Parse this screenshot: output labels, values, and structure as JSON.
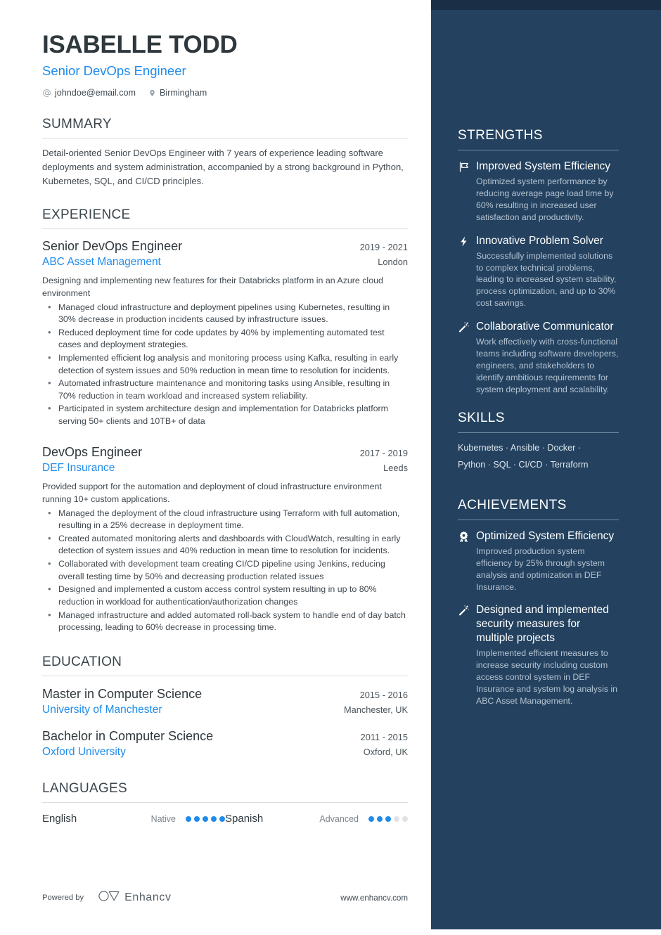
{
  "theme": {
    "accent_blue": "#1f8ceb",
    "sidebar_bg": "#24425f",
    "sidebar_topbar_bg": "#1a2f45",
    "heading_color": "#3b454c",
    "page_bg": "#ffffff"
  },
  "header": {
    "name": "ISABELLE TODD",
    "role": "Senior DevOps Engineer",
    "contacts": [
      {
        "icon": "at-icon",
        "text": "johndoe@email.com"
      },
      {
        "icon": "location-pin-icon",
        "text": "Birmingham"
      }
    ]
  },
  "summary": {
    "heading": "SUMMARY",
    "text": "Detail-oriented Senior DevOps Engineer with 7 years of experience leading software deployments and system administration, accompanied by a strong background in Python, Kubernetes, SQL, and CI/CD principles."
  },
  "experience": {
    "heading": "EXPERIENCE",
    "jobs": [
      {
        "title": "Senior DevOps Engineer",
        "dates": "2019 - 2021",
        "company": "ABC Asset Management",
        "location": "London",
        "description": "Designing and implementing new features for their Databricks platform in an Azure cloud environment",
        "bullets": [
          "Managed cloud infrastructure and deployment pipelines using Kubernetes, resulting in 30% decrease in production incidents caused by infrastructure issues.",
          "Reduced deployment time for code updates by 40% by implementing automated test cases and deployment strategies.",
          "Implemented efficient log analysis and monitoring process using Kafka, resulting in early detection of system issues and 50% reduction in mean time to resolution for incidents.",
          "Automated infrastructure maintenance and monitoring tasks using Ansible, resulting in 70% reduction in team workload and increased system reliability.",
          "Participated in system architecture design and implementation for Databricks platform serving 50+ clients and 10TB+ of data"
        ]
      },
      {
        "title": "DevOps Engineer",
        "dates": "2017 - 2019",
        "company": "DEF Insurance",
        "location": "Leeds",
        "description": "Provided support for the automation and deployment of cloud infrastructure environment running 10+ custom applications.",
        "bullets": [
          "Managed the deployment of the cloud infrastructure using Terraform with full automation, resulting in a 25% decrease in deployment time.",
          "Created automated monitoring alerts and dashboards with CloudWatch, resulting in early detection of system issues and 40% reduction in mean time to resolution for incidents.",
          "Collaborated with development team creating CI/CD pipeline using Jenkins, reducing overall testing time by 50% and decreasing production related issues",
          "Designed and implemented a custom access control system resulting in up to 80% reduction in workload for authentication/authorization changes",
          "Managed infrastructure and added automated roll-back system to handle end of day batch processing, leading to 60% decrease in processing time."
        ]
      }
    ]
  },
  "education": {
    "heading": "EDUCATION",
    "entries": [
      {
        "degree": "Master in Computer Science",
        "dates": "2015 - 2016",
        "school": "University of Manchester",
        "location": "Manchester, UK"
      },
      {
        "degree": "Bachelor in Computer Science",
        "dates": "2011 - 2015",
        "school": "Oxford University",
        "location": "Oxford, UK"
      }
    ]
  },
  "languages": {
    "heading": "LANGUAGES",
    "items": [
      {
        "name": "English",
        "level": "Native",
        "filled": 5,
        "total": 5
      },
      {
        "name": "Spanish",
        "level": "Advanced",
        "filled": 3,
        "total": 5
      }
    ]
  },
  "footer": {
    "powered_by": "Powered by",
    "brand": "Enhancv",
    "website": "www.enhancv.com"
  },
  "strengths": {
    "heading": "STRENGTHS",
    "items": [
      {
        "icon": "flag-icon",
        "title": "Improved System Efficiency",
        "desc": "Optimized system performance by reducing average page load time by 60% resulting in increased user satisfaction and productivity."
      },
      {
        "icon": "lightning-bolt-icon",
        "title": "Innovative Problem Solver",
        "desc": "Successfully implemented solutions to complex technical problems, leading to increased system stability, process optimization, and up to 30% cost savings."
      },
      {
        "icon": "magic-wand-icon",
        "title": "Collaborative Communicator",
        "desc": "Work effectively with cross-functional teams including software developers, engineers, and stakeholders to identify ambitious requirements for system deployment and scalability."
      }
    ]
  },
  "skills": {
    "heading": "SKILLS",
    "lines": [
      "Kubernetes · Ansible · Docker ·",
      "Python · SQL · CI/CD · Terraform"
    ]
  },
  "achievements": {
    "heading": "ACHIEVEMENTS",
    "items": [
      {
        "icon": "award-medal-icon",
        "title": "Optimized System Efficiency",
        "desc": "Improved production system efficiency by 25% through system analysis and optimization in DEF Insurance."
      },
      {
        "icon": "magic-wand-icon",
        "title": "Designed and implemented security measures for multiple projects",
        "desc": "Implemented efficient measures to increase security including custom access control system in DEF Insurance and system log analysis in ABC Asset Management."
      }
    ]
  }
}
